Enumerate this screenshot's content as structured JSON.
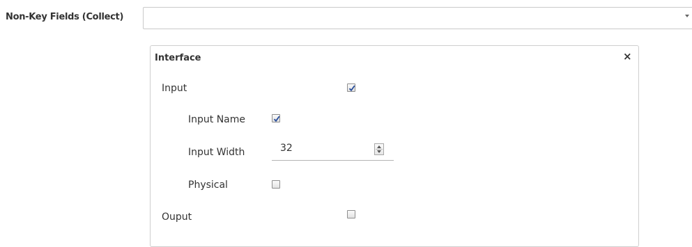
{
  "field": {
    "label": "Non-Key Fields (Collect)",
    "value": ""
  },
  "panel": {
    "title": "Interface",
    "close_icon": "close-icon"
  },
  "rows": {
    "input": {
      "label": "Input",
      "checked": true
    },
    "input_name": {
      "label": "Input Name",
      "checked": true
    },
    "input_width": {
      "label": "Input Width",
      "value": "32"
    },
    "physical": {
      "label": "Physical",
      "checked": false
    },
    "output": {
      "label": "Ouput",
      "checked": false
    }
  },
  "icons": {
    "close": "×",
    "checkmark": "checkmark-icon",
    "spinner": "up-down-spinner-icon"
  },
  "colors": {
    "check": "#2a4f9c",
    "border": "#c9c9c9"
  }
}
